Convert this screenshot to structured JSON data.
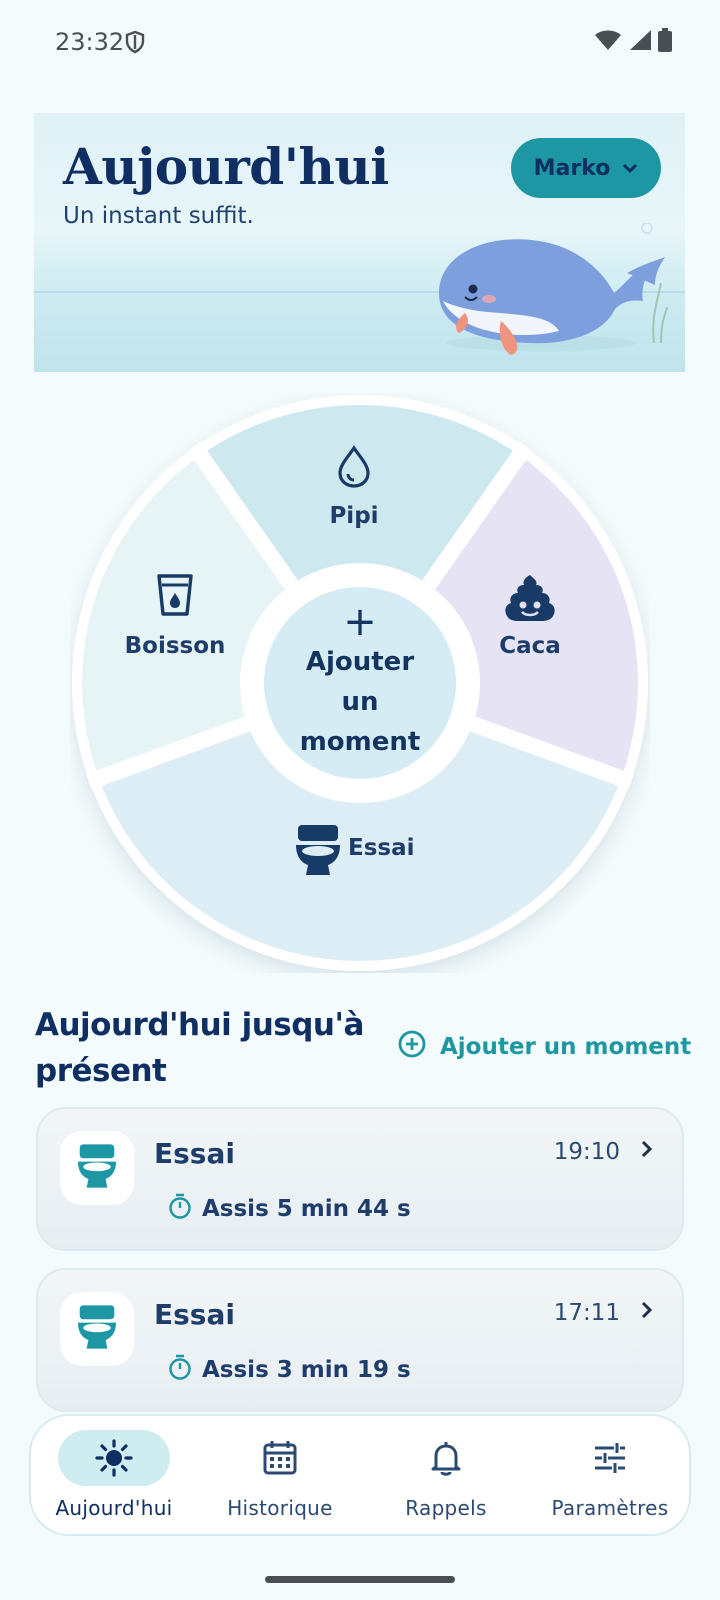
{
  "status_bar": {
    "time": "23:32"
  },
  "header": {
    "title": "Aujourd'hui",
    "subtitle": "Un instant suffit.",
    "profile_name": "Marko"
  },
  "wheel": {
    "segments": [
      {
        "id": "pipi",
        "label": "Pipi",
        "icon": "drop-icon"
      },
      {
        "id": "caca",
        "label": "Caca",
        "icon": "poop-icon"
      },
      {
        "id": "essai",
        "label": "Essai",
        "icon": "toilet-icon"
      },
      {
        "id": "boisson",
        "label": "Boisson",
        "icon": "cup-icon"
      }
    ],
    "center_plus": "+",
    "center_label": "Ajouter un moment"
  },
  "today": {
    "title": "Aujourd'hui jusqu'à présent",
    "add_label": "Ajouter un moment",
    "entries": [
      {
        "title": "Essai",
        "time": "19:10",
        "duration": "Assis 5 min 44 s"
      },
      {
        "title": "Essai",
        "time": "17:11",
        "duration": "Assis 3 min 19 s"
      }
    ]
  },
  "nav": {
    "items": [
      {
        "label": "Aujourd'hui",
        "icon": "sun-icon"
      },
      {
        "label": "Historique",
        "icon": "calendar-icon"
      },
      {
        "label": "Rappels",
        "icon": "bell-icon"
      },
      {
        "label": "Paramètres",
        "icon": "sliders-icon"
      }
    ]
  },
  "colors": {
    "accent": "#1d97a3",
    "navy": "#0f2f63",
    "pipi_segment": "#cde9ef",
    "caca_segment": "#e6e3f5",
    "essai_segment": "#dcedf5",
    "boisson_segment": "#e6f4f6"
  }
}
